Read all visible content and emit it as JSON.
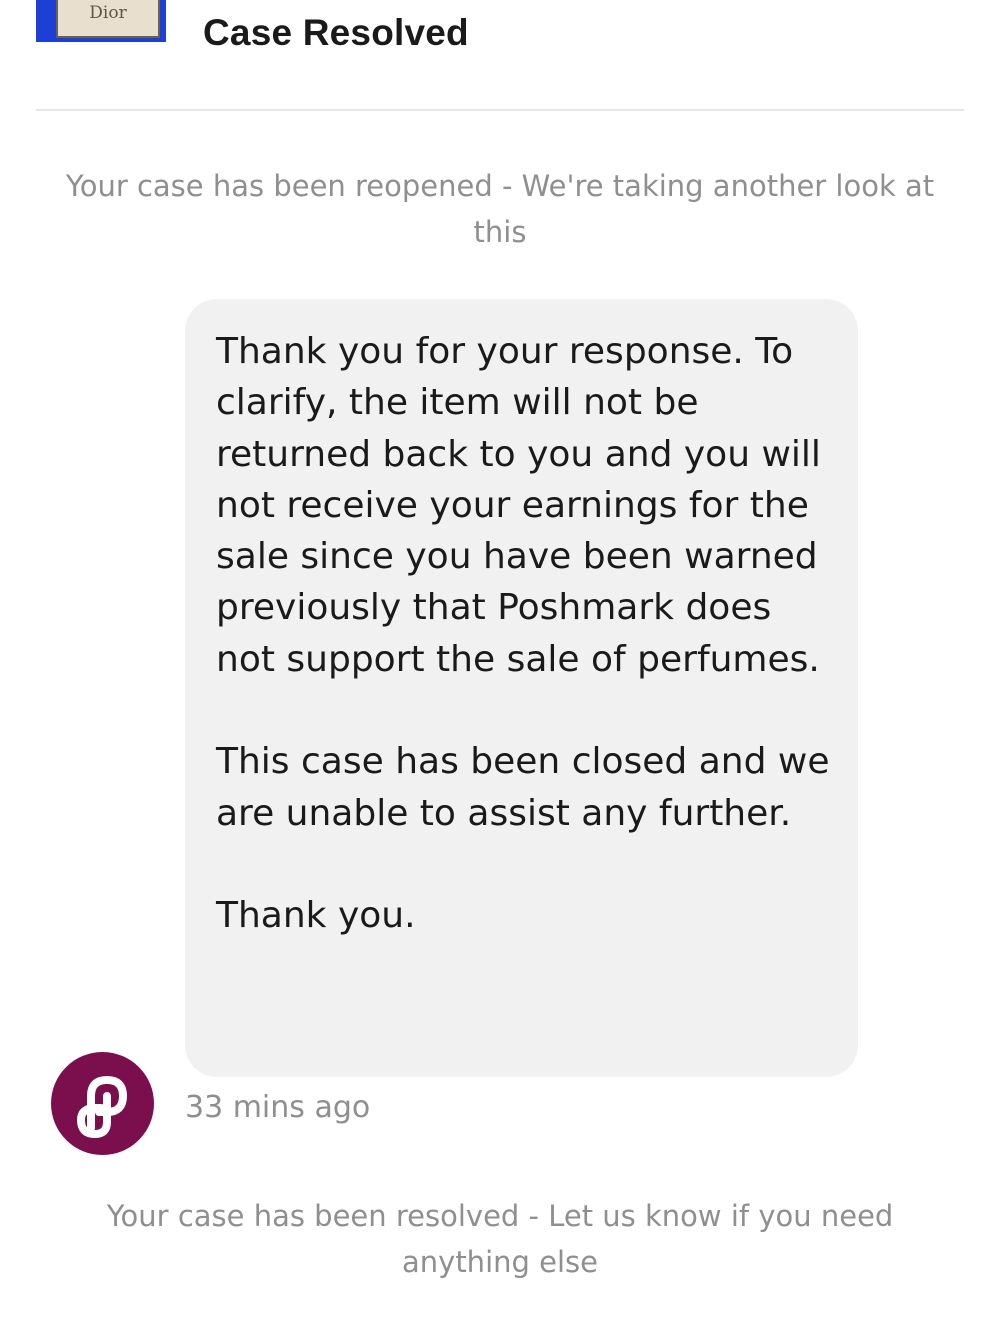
{
  "header": {
    "thumbnail_brand": "Dior",
    "title": "Case Resolved"
  },
  "system_notes": {
    "reopened": "Your case has been reopened - We're taking another look at this",
    "resolved": "Your case has been resolved - Let us know if you need anything else"
  },
  "message": {
    "paragraphs": [
      "Thank you for your response. To clarify, the item will not be returned back to you and you will not receive your earnings for the sale since you have been warned previously that Poshmark does not support the sale of perfumes.",
      "This case has been closed and we are unable to assist any further.",
      "Thank you."
    ],
    "timestamp": "33 mins ago",
    "sender_avatar_icon": "poshmark-logo-icon"
  },
  "colors": {
    "brand": "#7b0f4d",
    "bubble": "#f1f1f1",
    "muted_text": "#8f8f8f"
  }
}
